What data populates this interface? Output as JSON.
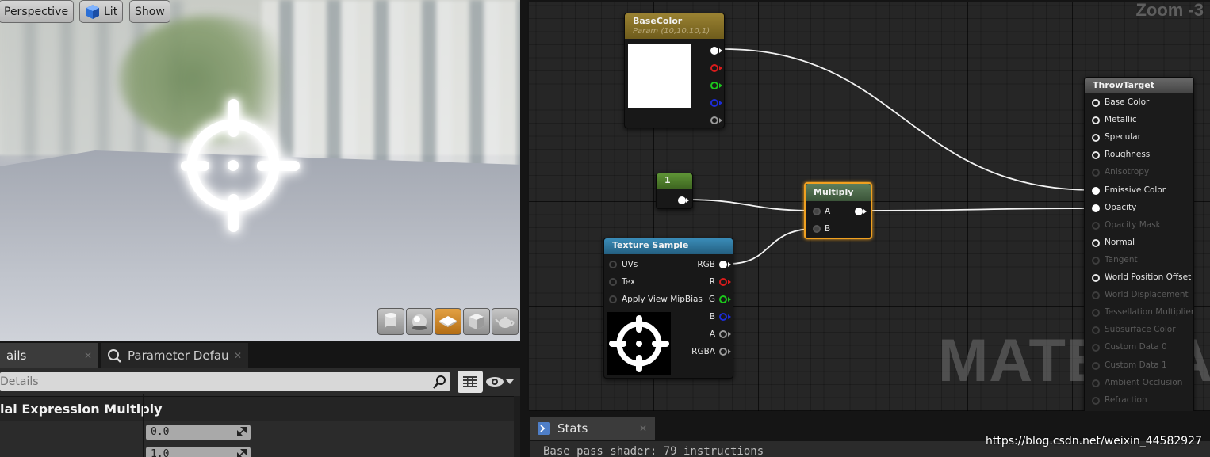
{
  "viewport": {
    "buttons": {
      "perspective": "Perspective",
      "lit": "Lit",
      "show": "Show"
    },
    "preview_tools": [
      "cylinder-icon",
      "sphere-icon",
      "plane-icon",
      "cube-icon",
      "teapot-icon"
    ],
    "active_tool": "plane-icon"
  },
  "details": {
    "tabs": [
      {
        "label": "ails",
        "close": "✕"
      },
      {
        "label": "Parameter Defaults",
        "close": "✕"
      }
    ],
    "search_placeholder": "Details",
    "section_title": "ial Expression Multiply",
    "properties": [
      {
        "value": "0.0"
      },
      {
        "value": "1.0"
      }
    ]
  },
  "graph": {
    "zoom": "Zoom -3",
    "watermark": "MATERIAL",
    "nodes": {
      "basecolor": {
        "title": "BaseColor",
        "subtitle": "Param (10,10,10,1)"
      },
      "constant": {
        "title": "1"
      },
      "multiply": {
        "title": "Multiply",
        "inputs": [
          "A",
          "B"
        ]
      },
      "texture": {
        "title": "Texture Sample",
        "inputs": [
          "UVs",
          "Tex",
          "Apply View MipBias"
        ],
        "outputs": [
          "RGB",
          "R",
          "G",
          "B",
          "A",
          "RGBA"
        ]
      },
      "result": {
        "title": "ThrowTarget",
        "pins": [
          {
            "label": "Base Color",
            "enabled": true,
            "connected": false
          },
          {
            "label": "Metallic",
            "enabled": true,
            "connected": false
          },
          {
            "label": "Specular",
            "enabled": true,
            "connected": false
          },
          {
            "label": "Roughness",
            "enabled": true,
            "connected": false
          },
          {
            "label": "Anisotropy",
            "enabled": false,
            "connected": false
          },
          {
            "label": "Emissive Color",
            "enabled": true,
            "connected": true
          },
          {
            "label": "Opacity",
            "enabled": true,
            "connected": true
          },
          {
            "label": "Opacity Mask",
            "enabled": false,
            "connected": false
          },
          {
            "label": "Normal",
            "enabled": true,
            "connected": false
          },
          {
            "label": "Tangent",
            "enabled": false,
            "connected": false
          },
          {
            "label": "World Position Offset",
            "enabled": true,
            "connected": false
          },
          {
            "label": "World Displacement",
            "enabled": false,
            "connected": false
          },
          {
            "label": "Tessellation Multiplier",
            "enabled": false,
            "connected": false
          },
          {
            "label": "Subsurface Color",
            "enabled": false,
            "connected": false
          },
          {
            "label": "Custom Data 0",
            "enabled": false,
            "connected": false
          },
          {
            "label": "Custom Data 1",
            "enabled": false,
            "connected": false
          },
          {
            "label": "Ambient Occlusion",
            "enabled": false,
            "connected": false
          },
          {
            "label": "Refraction",
            "enabled": false,
            "connected": false
          }
        ]
      }
    },
    "colors": {
      "param_header": "#8a7326",
      "constant_header": "#4c7a2c",
      "multiply_header": "#4b6b4a",
      "texture_header": "#2f7aa1",
      "result_header": "#5e5e5e",
      "selection": "#f0a020",
      "pin_red": "#d81c1c",
      "pin_green": "#1cc61c",
      "pin_blue": "#1c2cd8"
    }
  },
  "stats": {
    "tab_label": "Stats",
    "close": "✕",
    "line": "Base pass shader: 79 instructions"
  },
  "watermark_url": "https://blog.csdn.net/weixin_44582927"
}
